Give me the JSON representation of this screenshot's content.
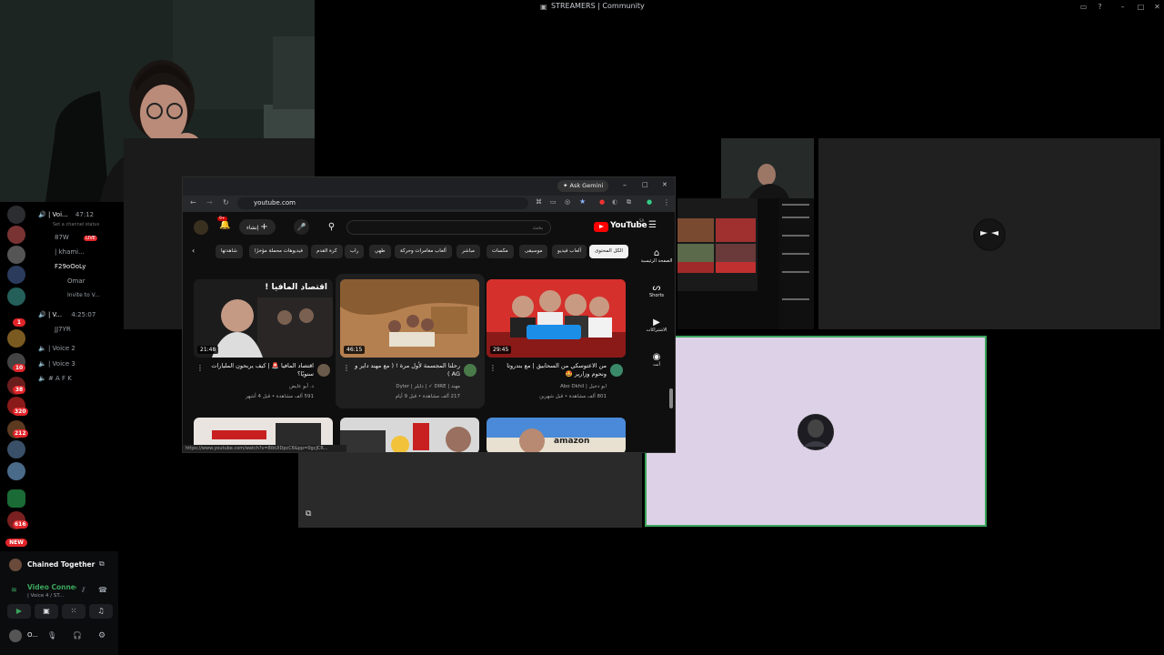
{
  "window": {
    "title": "STREAMERS | Community"
  },
  "channels": {
    "voice_channel_1": "| Voi...",
    "voice_timer_1": "47:12",
    "channel_status_hint": "Set a channel status",
    "user_1": "87W",
    "live_badge": "LIVE",
    "user_2": "| khami...",
    "user_3": "F29oOoLy",
    "user_4": "Omar",
    "invite": "Invite to V...",
    "voice_channel_2": "| V...",
    "voice_timer_2": "4:25:07",
    "user_5": "JJ7YR",
    "voice_channel_3": "| Voice 2",
    "voice_channel_4": "| Voice 3",
    "text_channel": "# A F K"
  },
  "server_badges": [
    "1",
    "10",
    "38",
    "320",
    "212",
    "616",
    "NEW"
  ],
  "activity": {
    "game": "Chained Together"
  },
  "voice_panel": {
    "status": "Video Connect",
    "location": "| Voice 4 / ST..."
  },
  "user_panel": {
    "name": "O..."
  },
  "browser": {
    "gemini": "Ask Gemini",
    "url": "youtube.com",
    "status_url": "https://www.youtube.com/watch?v=8ibUlDpcC6&pp=0gcJCR..."
  },
  "youtube": {
    "logo": "YouTube",
    "region": "SA",
    "search_placeholder": "بحث",
    "create_label": "إنشاء",
    "notif_count": "9+",
    "chips": [
      "الكل المحتوى",
      "ألعاب فيديو",
      "موسيقى",
      "مكسات",
      "مباشر",
      "ألعاب مغامرات وحركة",
      "طهي",
      "راب",
      "كرة القدم",
      "فيديوهات محملة مؤخرًا",
      "شاهدتها"
    ],
    "side_items": [
      "الصفحة الرئيسية",
      "Shorts",
      "الاشتراكات",
      "أنت"
    ],
    "videos": [
      {
        "duration": "29:45",
        "title": "من الاعتوسكي من السحابيق | مع بندروتا ونحوم وزارير 🤩",
        "channel": "ابو دخيل | Abo Dkhil",
        "meta": "801 ألف مشاهدة • قبل شهرين"
      },
      {
        "duration": "46:15",
        "title": "رحلنا المجسمة لأول مرة ! ( مع مهند داير و AG )",
        "channel": "مهند | DIRE ✓ | دايلر | Dyler",
        "meta": "217 ألف مشاهدة • قبل 9 أيام"
      },
      {
        "duration": "21:48",
        "title": "اقتصاد المافيا 🚨 | كيف يربحون المليارات سنويًا؟",
        "channel": "د. أبو عايض",
        "meta": "591 ألف مشاهدة • قبل 4 أشهر"
      }
    ],
    "thumb_text_1": "اقتصاد المافيا !",
    "thumb_text_amazon": "amazon"
  },
  "colors": {
    "discord_green": "#3ba55d",
    "discord_red": "#e0252a",
    "youtube_red": "#ff0000",
    "tile_purple": "#dcd1e6"
  }
}
